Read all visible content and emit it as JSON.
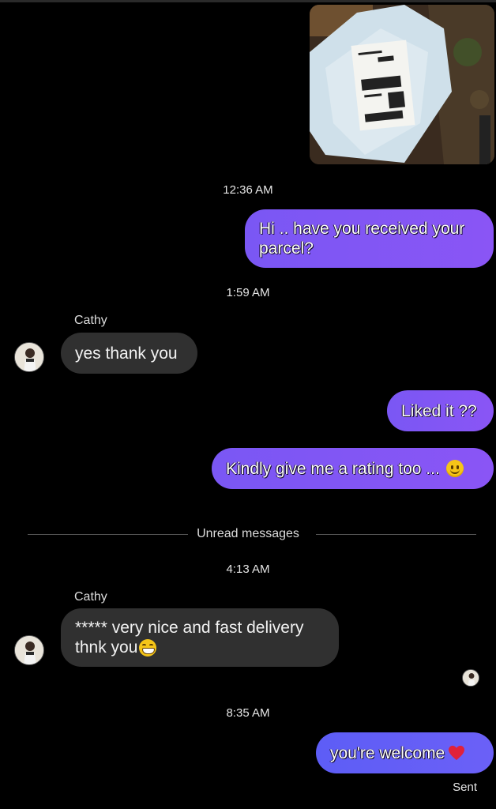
{
  "colors": {
    "outgoing_bubble": "#7a57f4",
    "outgoing_bubble_last": "#5d5df6",
    "incoming_bubble": "#303030",
    "background": "#000000"
  },
  "conversation": {
    "contact_name": "Cathy",
    "timestamps": [
      "12:36 AM",
      "1:59 AM",
      "4:13 AM",
      "8:35 AM"
    ],
    "unread_divider": "Unread messages",
    "status": "Sent",
    "messages": [
      {
        "from": "me",
        "text": "Hi .. have you received your parcel?"
      },
      {
        "from": "Cathy",
        "text": "yes thank you"
      },
      {
        "from": "me",
        "text": "Liked it ??"
      },
      {
        "from": "me",
        "text": "Kindly give me a rating too ...",
        "emoji": "smiling-face-icon"
      },
      {
        "from": "Cathy",
        "text_line1": "***** very nice and fast delivery",
        "text_line2": "thnk you",
        "emoji": "grinning-face-icon"
      },
      {
        "from": "me",
        "text": "you're welcome",
        "emoji": "red-heart-icon"
      }
    ]
  }
}
